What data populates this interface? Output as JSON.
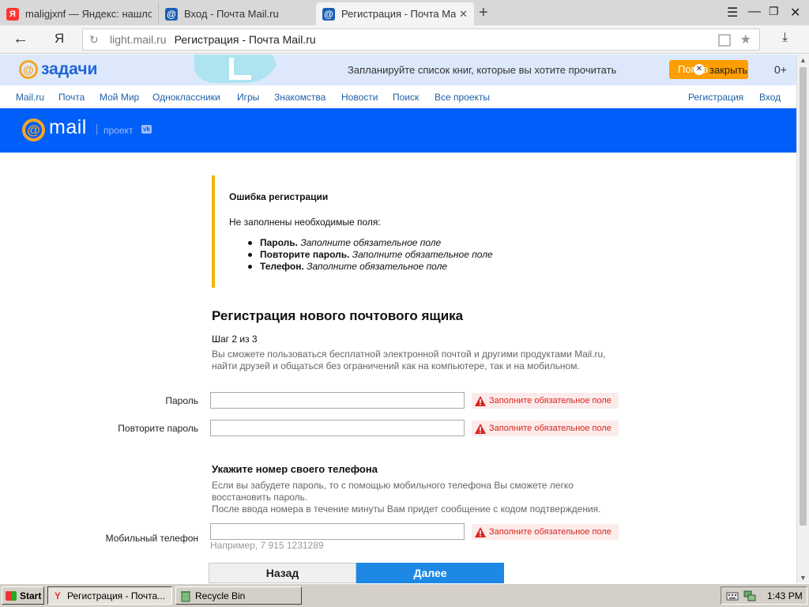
{
  "browser": {
    "tabs": [
      {
        "label": "maligjxnf — Яндекс: нашлось",
        "favicon": "Я",
        "active": false
      },
      {
        "label": "Вход - Почта Mail.ru",
        "favicon": "@",
        "active": false
      },
      {
        "label": "Регистрация - Почта Mail.ru",
        "favicon": "@",
        "active": true
      }
    ],
    "new_tab_icon": "+",
    "address": {
      "logo": "Я",
      "domain": "light.mail.ru",
      "page_title": "Регистрация - Почта Mail.ru"
    }
  },
  "promo": {
    "logo_symbol": "@",
    "logo_text": "задачи",
    "text": "Запланируйте список книг, которые вы хотите прочитать",
    "button_label": "Попро",
    "close_label": "закрыть",
    "age_rating": "0+"
  },
  "portal_menu": {
    "items": [
      "Mail.ru",
      "Почта",
      "Мой Мир",
      "Одноклассники",
      "Игры",
      "Знакомства",
      "Новости",
      "Поиск",
      "Все проекты"
    ],
    "register": "Регистрация",
    "login": "Вход"
  },
  "mail_header": {
    "logo_symbol": "@",
    "logo_text": "mail",
    "project_text": "проект",
    "vk_badge": "vk"
  },
  "error": {
    "title": "Ошибка регистрации",
    "subtitle": "Не заполнены необходимые поля:",
    "items": [
      {
        "field": "Пароль.",
        "message": "Заполните обязательное поле"
      },
      {
        "field": "Повторите пароль.",
        "message": "Заполните обязательное поле"
      },
      {
        "field": "Телефон.",
        "message": "Заполните обязательное поле"
      }
    ]
  },
  "form": {
    "title": "Регистрация нового почтового ящика",
    "step": "Шаг 2 из 3",
    "description_line1": "Вы сможете пользоваться бесплатной электронной почтой и другими продуктами Mail.ru,",
    "description_line2": "найти друзей и общаться без ограничений как на компьютере, так и на мобильном.",
    "password_label": "Пароль",
    "password_value": "",
    "password_error": "Заполните обязательное поле",
    "repeat_label": "Повторите пароль",
    "repeat_value": "",
    "repeat_error": "Заполните обязательное поле",
    "phone_section_title": "Укажите номер своего телефона",
    "phone_desc_line1": "Если вы забудете пароль, то с помощью мобильного телефона Вы сможете легко",
    "phone_desc_line2": "восстановить пароль.",
    "phone_desc_line3": "После ввода номера в течение минуты Вам придет сообщение с кодом подтверждения.",
    "phone_label": "Мобильный телефон",
    "phone_value": "",
    "phone_error": "Заполните обязательное поле",
    "phone_hint": "Например, 7 915 1231289",
    "back_button": "Назад",
    "next_button": "Далее"
  },
  "taskbar": {
    "start_label": "Start",
    "tasks": [
      {
        "label": "Регистрация - Почта...",
        "active": true
      },
      {
        "label": "Recycle Bin",
        "active": false
      }
    ],
    "clock": "1:43 PM"
  },
  "colors": {
    "mail_blue": "#005ff9",
    "mail_orange": "#f5a623",
    "error_red": "#d8261f",
    "warning_yellow": "#f5b400",
    "next_button_blue": "#1e88e5",
    "link_blue": "#1d5fa8"
  }
}
